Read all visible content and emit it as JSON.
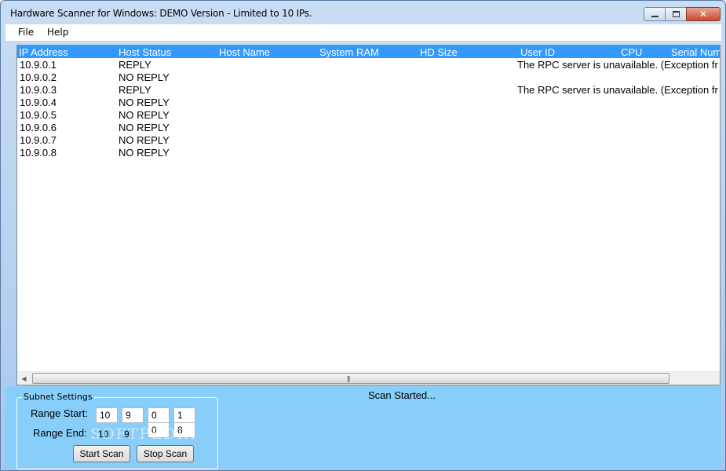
{
  "window": {
    "title": "Hardware Scanner for Windows: DEMO Version - Limited to 10 IPs."
  },
  "menu": {
    "file": "File",
    "help": "Help"
  },
  "table": {
    "columns": [
      "IP Address",
      "Host Status",
      "Host Name",
      "System RAM",
      "HD Size",
      "User ID",
      "CPU",
      "Serial Num"
    ],
    "rows": [
      {
        "ip": "10.9.0.1",
        "status": "REPLY",
        "user": "The RPC server is unavailable. (Exception fr"
      },
      {
        "ip": "10.9.0.2",
        "status": "NO REPLY",
        "user": ""
      },
      {
        "ip": "10.9.0.3",
        "status": "REPLY",
        "user": "The RPC server is unavailable. (Exception fr"
      },
      {
        "ip": "10.9.0.4",
        "status": "NO REPLY",
        "user": ""
      },
      {
        "ip": "10.9.0.5",
        "status": "NO REPLY",
        "user": ""
      },
      {
        "ip": "10.9.0.6",
        "status": "NO REPLY",
        "user": ""
      },
      {
        "ip": "10.9.0.7",
        "status": "NO REPLY",
        "user": ""
      },
      {
        "ip": "10.9.0.8",
        "status": "NO REPLY",
        "user": ""
      }
    ]
  },
  "subnet": {
    "title": "Subnet Settings",
    "range_start_label": "Range Start:",
    "range_end_label": "Range End:",
    "start": [
      "10",
      "9",
      "0",
      "1"
    ],
    "end": [
      "10",
      "9",
      "0",
      "8"
    ],
    "start_button": "Start Scan",
    "stop_button": "Stop Scan"
  },
  "status_text": "Scan Started...",
  "watermark": "SOFTPEDIA",
  "colors": {
    "header_blue": "#3399ff",
    "panel_blue": "#87cefa"
  }
}
